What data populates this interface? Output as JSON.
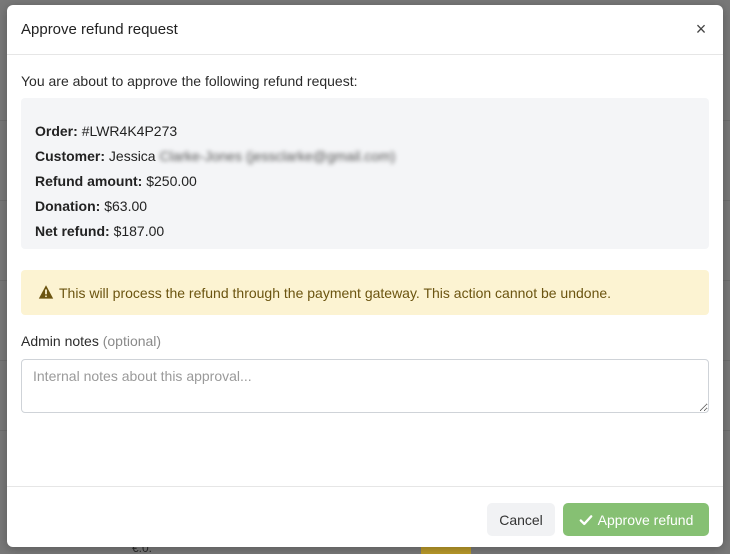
{
  "modal": {
    "title": "Approve refund request",
    "close_glyph": "×",
    "intro": "You are about to approve the following refund request:"
  },
  "summary": {
    "order_label": "Order:",
    "order_value": "#LWR4K4P273",
    "customer_label": "Customer:",
    "customer_first": "Jessica",
    "customer_redacted": "Clarke-Jones (jessclarke@gmail.com)",
    "refund_label": "Refund amount:",
    "refund_value": "$250.00",
    "donation_label": "Donation:",
    "donation_value": "$63.00",
    "net_label": "Net refund:",
    "net_value": "$187.00"
  },
  "warning": {
    "icon": "warning-triangle-icon",
    "text": "This will process the refund through the payment gateway. This action cannot be undone.",
    "color": "#6b5410",
    "background": "#fcf3d2"
  },
  "notes": {
    "label": "Admin notes",
    "optional": "(optional)",
    "placeholder": "Internal notes about this approval...",
    "value": ""
  },
  "footer": {
    "cancel_label": "Cancel",
    "approve_label": "Approve refund",
    "approve_icon": "check-icon",
    "approve_color": "#86c073"
  },
  "background": {
    "partial_text": "€.0."
  }
}
